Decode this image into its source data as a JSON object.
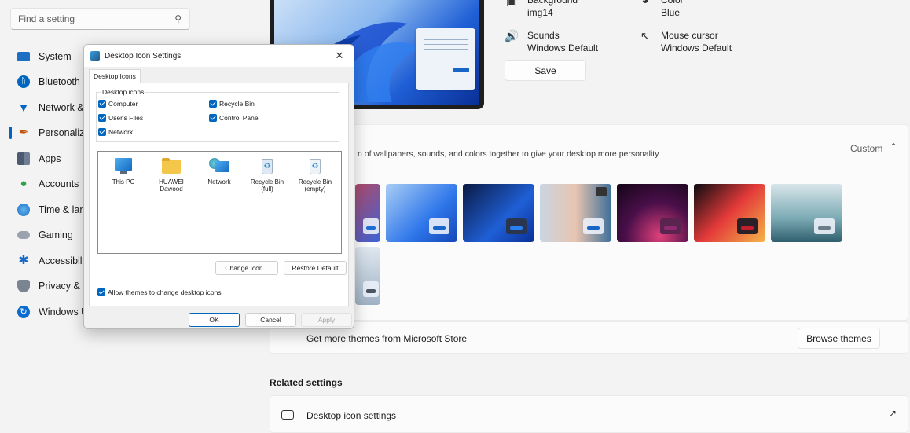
{
  "sidebar": {
    "search_placeholder": "Find a setting",
    "items": [
      {
        "label": "System",
        "icon": "monitor-icon",
        "color": "#0f6cbd"
      },
      {
        "label": "Bluetooth & devices",
        "icon": "bluetooth-icon",
        "color": "#0067c0"
      },
      {
        "label": "Network & internet",
        "icon": "wifi-icon",
        "color": "#0067c0"
      },
      {
        "label": "Personalization",
        "icon": "brush-icon",
        "color": "#c2550e"
      },
      {
        "label": "Apps",
        "icon": "apps-icon",
        "color": "#4a5a70"
      },
      {
        "label": "Accounts",
        "icon": "person-icon",
        "color": "#2fa34a"
      },
      {
        "label": "Time & language",
        "icon": "globe-clock-icon",
        "color": "#1a8bd8"
      },
      {
        "label": "Gaming",
        "icon": "gamepad-icon",
        "color": "#6b7280"
      },
      {
        "label": "Accessibility",
        "icon": "accessibility-icon",
        "color": "#1769c7"
      },
      {
        "label": "Privacy & security",
        "icon": "shield-icon",
        "color": "#7b8592"
      },
      {
        "label": "Windows Update",
        "icon": "update-icon",
        "color": "#0a6cd1"
      }
    ]
  },
  "theme_summary": {
    "background_label": "Background",
    "background_value": "img14",
    "color_label": "Color",
    "color_value": "Blue",
    "sounds_label": "Sounds",
    "sounds_value": "Windows Default",
    "cursor_label": "Mouse cursor",
    "cursor_value": "Windows Default",
    "save_label": "Save"
  },
  "themes_section": {
    "description": "n of wallpapers, sounds, and colors together to give your desktop more personality",
    "current": "Custom",
    "store_text": "Get more themes from Microsoft Store",
    "browse_label": "Browse themes"
  },
  "related": {
    "heading": "Related settings",
    "desktop_icon_settings": "Desktop icon settings"
  },
  "dialog": {
    "title": "Desktop Icon Settings",
    "tab": "Desktop Icons",
    "group_label": "Desktop icons",
    "checkboxes": {
      "computer": "Computer",
      "recycle_bin": "Recycle Bin",
      "users_files": "User's Files",
      "control_panel": "Control Panel",
      "network": "Network"
    },
    "icons": [
      {
        "label": "This PC",
        "label2": ""
      },
      {
        "label": "HUAWEI",
        "label2": "Dawood"
      },
      {
        "label": "Network",
        "label2": ""
      },
      {
        "label": "Recycle Bin",
        "label2": "(full)"
      },
      {
        "label": "Recycle Bin",
        "label2": "(empty)"
      }
    ],
    "change_icon": "Change Icon...",
    "restore_default": "Restore Default",
    "allow_themes": "Allow themes to change desktop icons",
    "ok": "OK",
    "cancel": "Cancel",
    "apply": "Apply"
  },
  "colors": {
    "accent": "#0067c0",
    "background": "#f3f3f3"
  }
}
